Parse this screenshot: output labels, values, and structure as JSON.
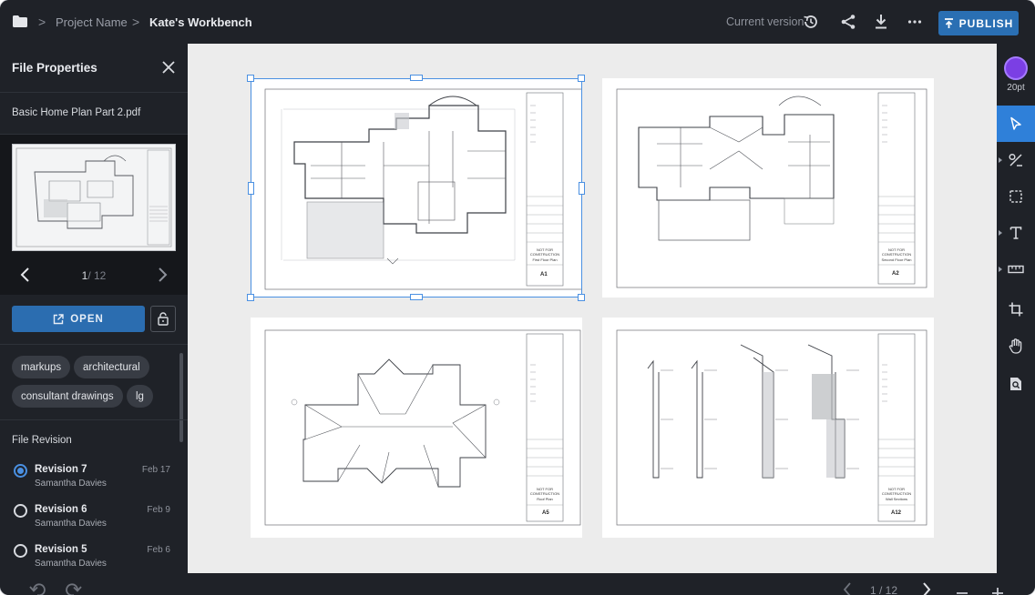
{
  "header": {
    "project_name": "Project Name",
    "workbench": "Kate's Workbench",
    "current_version": "Current version",
    "publish_label": "PUBLISH"
  },
  "file_panel": {
    "title": "File Properties",
    "file_name": "Basic Home Plan Part 2.pdf",
    "page_current": "1",
    "page_total": "/ 12",
    "open_label": "OPEN",
    "tags": [
      "markups",
      "architectural",
      "consultant drawings",
      "lg"
    ],
    "revision_title": "File Revision",
    "revisions": [
      {
        "name": "Revision 7",
        "author": "Samantha Davies",
        "date": "Feb 17",
        "selected": true
      },
      {
        "name": "Revision 6",
        "author": "Samantha Davies",
        "date": "Feb 9",
        "selected": false
      },
      {
        "name": "Revision 5",
        "author": "Samantha Davies",
        "date": "Feb 6",
        "selected": false
      }
    ]
  },
  "sheets": [
    {
      "id": "A1",
      "stamp": "NOT FOR CONSTRUCTION",
      "subtitle": "First Floor Plan",
      "selected": true
    },
    {
      "id": "A2",
      "stamp": "NOT FOR CONSTRUCTION",
      "subtitle": "Second Floor Plan",
      "selected": false
    },
    {
      "id": "A5",
      "stamp": "NOT FOR CONSTRUCTION",
      "subtitle": "Roof Plan",
      "selected": false
    },
    {
      "id": "A12",
      "stamp": "NOT FOR CONSTRUCTION",
      "subtitle": "Wall Sections",
      "selected": false
    }
  ],
  "toolbar": {
    "color": "#7b3fe4",
    "stroke_size": "20pt",
    "tools": [
      "select-tool-icon",
      "line-tool-icon",
      "area-tool-icon",
      "text-tool-icon",
      "measure-tool-icon",
      "crop-tool-icon",
      "pan-tool-icon",
      "zoom-search-icon"
    ],
    "active_tool": "select-tool-icon"
  },
  "footer": {
    "page_indicator": "1 / 12"
  },
  "colors": {
    "accent": "#2b6db0",
    "selection": "#4a90e2",
    "background_dark": "#1f2228",
    "canvas": "#ececec"
  }
}
